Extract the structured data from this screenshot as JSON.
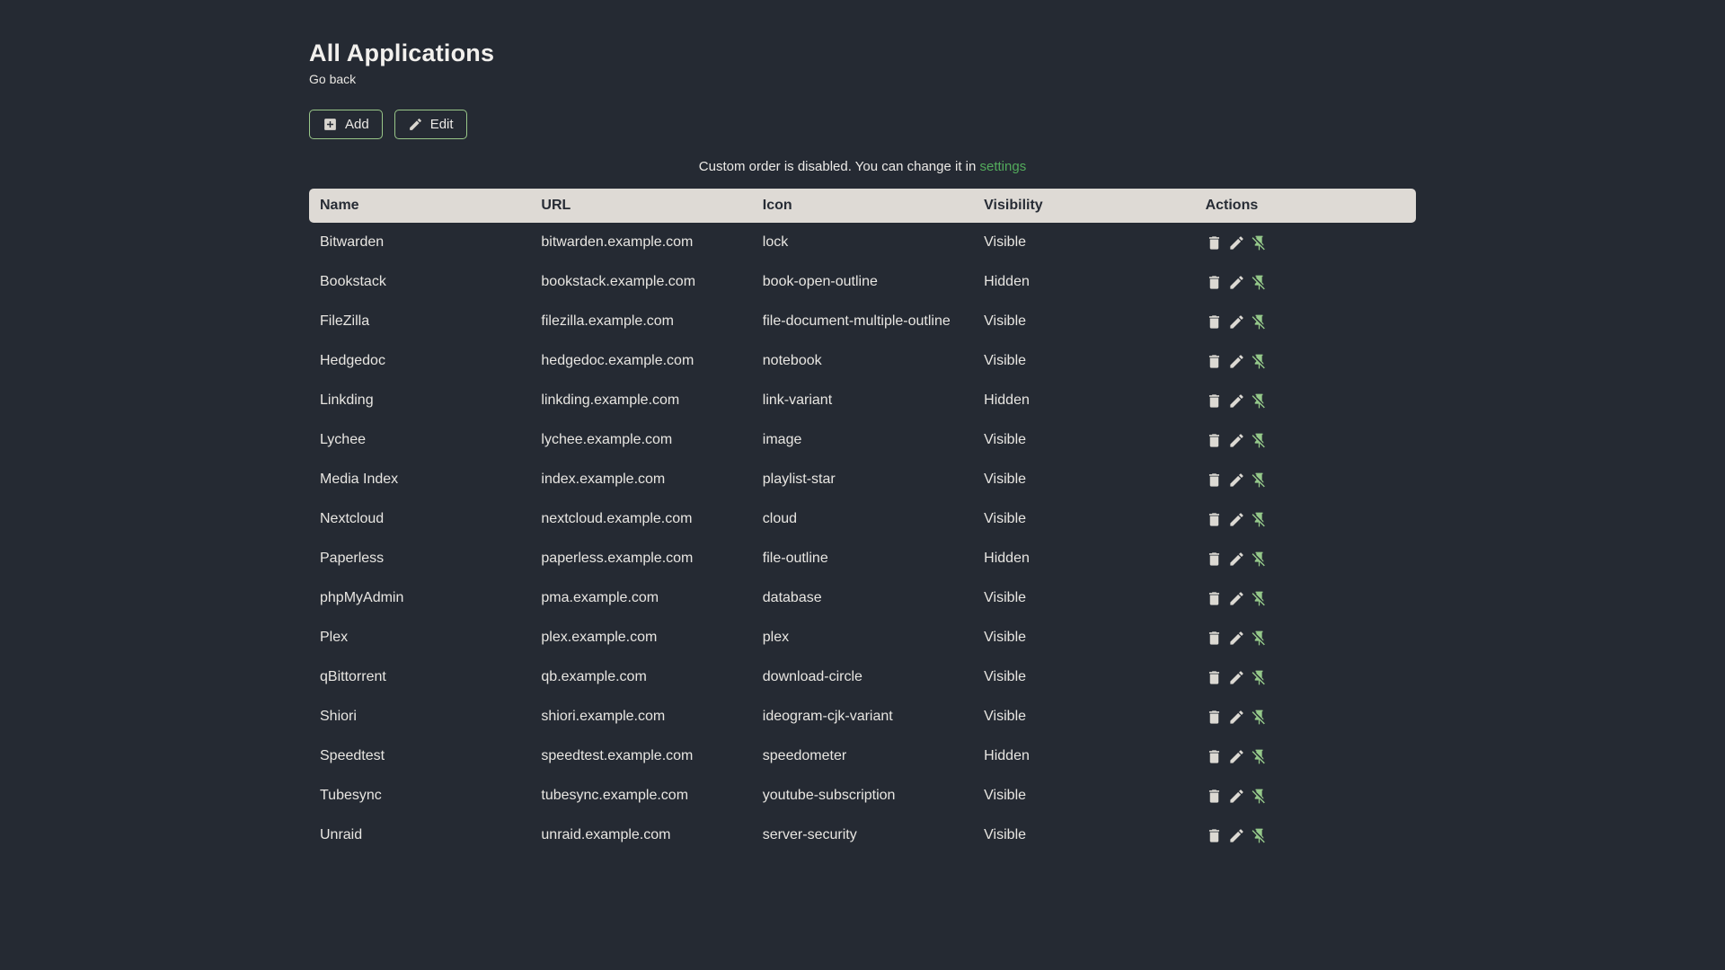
{
  "page": {
    "title": "All Applications",
    "back_label": "Go back",
    "notice": {
      "text": "Custom order is disabled. You can change it in ",
      "link_label": "settings"
    }
  },
  "toolbar": {
    "add_label": "Add",
    "edit_label": "Edit"
  },
  "colors": {
    "background": "#252a33",
    "table_header_bg": "#dedad5",
    "table_header_text": "#272c35",
    "body_text": "#e8e6e2",
    "button_border_green": "#99c789",
    "settings_link_green": "#53ab5c",
    "pin_icon_green": "#95c98a",
    "action_icon_light": "#dcd9d3"
  },
  "icons": {
    "add_button": "plus-box-icon",
    "edit_button": "pencil-icon",
    "row_actions": [
      "trash-icon",
      "pencil-icon",
      "pin-off-icon"
    ]
  },
  "table": {
    "columns": [
      "Name",
      "URL",
      "Icon",
      "Visibility",
      "Actions"
    ],
    "rows": [
      {
        "name": "Bitwarden",
        "url": "bitwarden.example.com",
        "icon": "lock",
        "visibility": "Visible"
      },
      {
        "name": "Bookstack",
        "url": "bookstack.example.com",
        "icon": "book-open-outline",
        "visibility": "Hidden"
      },
      {
        "name": "FileZilla",
        "url": "filezilla.example.com",
        "icon": "file-document-multiple-outline",
        "visibility": "Visible"
      },
      {
        "name": "Hedgedoc",
        "url": "hedgedoc.example.com",
        "icon": "notebook",
        "visibility": "Visible"
      },
      {
        "name": "Linkding",
        "url": "linkding.example.com",
        "icon": "link-variant",
        "visibility": "Hidden"
      },
      {
        "name": "Lychee",
        "url": "lychee.example.com",
        "icon": "image",
        "visibility": "Visible"
      },
      {
        "name": "Media Index",
        "url": "index.example.com",
        "icon": "playlist-star",
        "visibility": "Visible"
      },
      {
        "name": "Nextcloud",
        "url": "nextcloud.example.com",
        "icon": "cloud",
        "visibility": "Visible"
      },
      {
        "name": "Paperless",
        "url": "paperless.example.com",
        "icon": "file-outline",
        "visibility": "Hidden"
      },
      {
        "name": "phpMyAdmin",
        "url": "pma.example.com",
        "icon": "database",
        "visibility": "Visible"
      },
      {
        "name": "Plex",
        "url": "plex.example.com",
        "icon": "plex",
        "visibility": "Visible"
      },
      {
        "name": "qBittorrent",
        "url": "qb.example.com",
        "icon": "download-circle",
        "visibility": "Visible"
      },
      {
        "name": "Shiori",
        "url": "shiori.example.com",
        "icon": "ideogram-cjk-variant",
        "visibility": "Visible"
      },
      {
        "name": "Speedtest",
        "url": "speedtest.example.com",
        "icon": "speedometer",
        "visibility": "Hidden"
      },
      {
        "name": "Tubesync",
        "url": "tubesync.example.com",
        "icon": "youtube-subscription",
        "visibility": "Visible"
      },
      {
        "name": "Unraid",
        "url": "unraid.example.com",
        "icon": "server-security",
        "visibility": "Visible"
      }
    ]
  }
}
